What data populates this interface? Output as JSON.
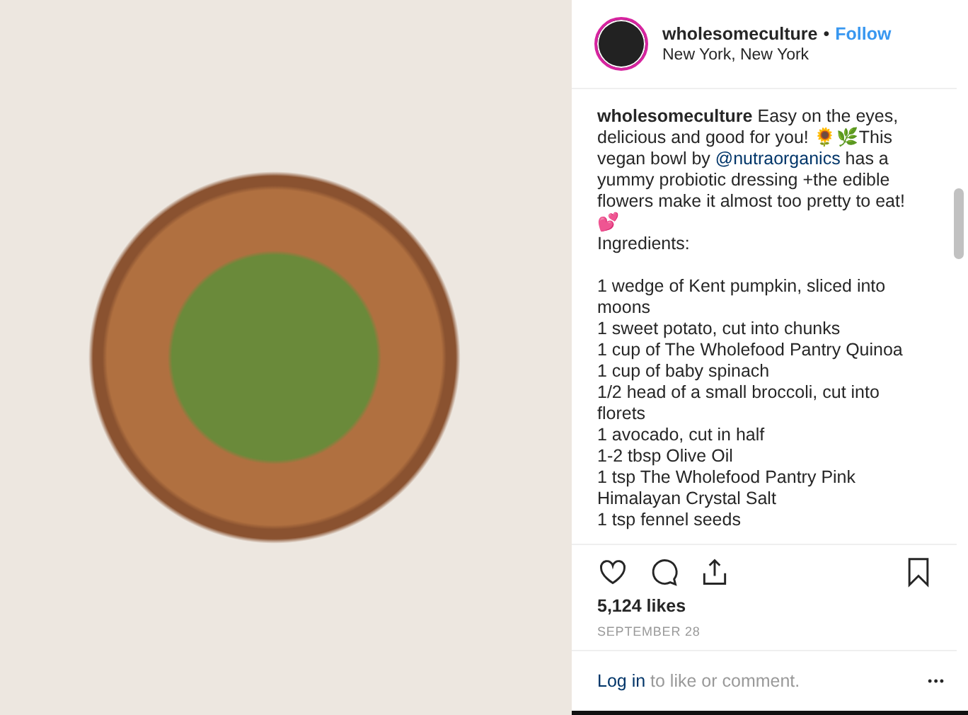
{
  "post": {
    "header": {
      "username": "wholesomeculture",
      "separator": "•",
      "follow": "Follow",
      "location": "New York, New York"
    },
    "caption": {
      "username": "wholesomeculture",
      "before": "Easy on the eyes, delicious and good for you! 🌻🌿This vegan bowl by ",
      "mention": "@nutraorganics",
      "after": " has a yummy probiotic dressing +the edible flowers make it almost too pretty to eat! 💕"
    },
    "ingredients_title": "Ingredients:",
    "ingredients": [
      "1 wedge of Kent pumpkin, sliced into moons",
      "1 sweet potato, cut into chunks",
      "1 cup of The Wholefood Pantry Quinoa",
      "1 cup of baby spinach",
      "1/2 head of a small broccoli, cut into florets",
      "1 avocado, cut in half",
      "1-2 tbsp Olive Oil",
      "1 tsp The Wholefood Pantry Pink Himalayan Crystal Salt",
      "1 tsp fennel seeds"
    ],
    "likes": "5,124 likes",
    "date": "SEPTEMBER 28",
    "footer": {
      "login": "Log in",
      "rest": " to like or comment.",
      "more": "•••"
    }
  }
}
